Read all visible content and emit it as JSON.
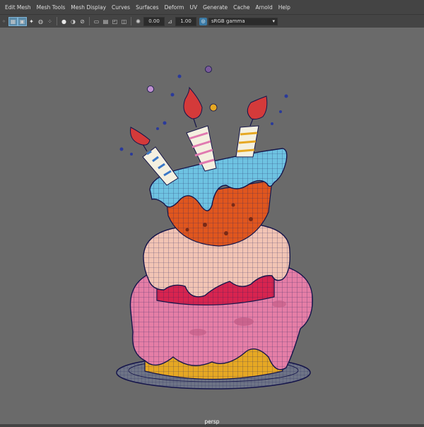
{
  "menu": [
    "Edit Mesh",
    "Mesh Tools",
    "Mesh Display",
    "Curves",
    "Surfaces",
    "Deform",
    "UV",
    "Generate",
    "Cache",
    "Arnold",
    "Help"
  ],
  "toolbar": {
    "exposure": "0.00",
    "gamma": "1.00",
    "color_space": "sRGB gamma"
  },
  "viewport": {
    "camera_label": "persp"
  }
}
